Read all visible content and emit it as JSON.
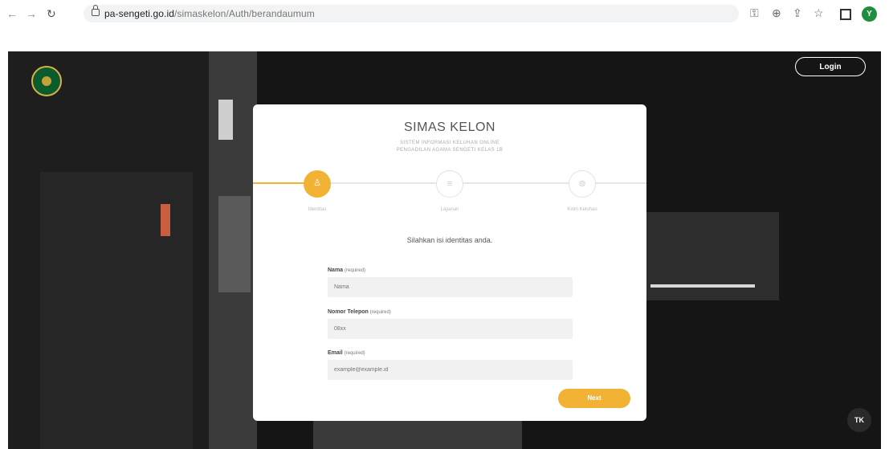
{
  "browser": {
    "url_host": "pa-sengeti.go.id",
    "url_path": "/simaskelon/Auth/berandaumum",
    "profile_initial": "Y"
  },
  "header": {
    "login_label": "Login"
  },
  "card": {
    "title": "SIMAS KELON",
    "subtitle_line1": "SISTEM INFORMASI KELUHAN ONLINE",
    "subtitle_line2": "PENGADILAN AGAMA SENGETI KELAS 1B",
    "steps": [
      {
        "label": "Identitas"
      },
      {
        "label": "Layanan"
      },
      {
        "label": "Kirim Keluhan"
      }
    ],
    "prompt": "Silahkan isi identitas anda.",
    "fields": {
      "name": {
        "label": "Nama",
        "req": "(required)",
        "placeholder": "Nama"
      },
      "phone": {
        "label": "Nomor Telepon",
        "req": "(required)",
        "placeholder": "08xx"
      },
      "email": {
        "label": "Email",
        "req": "(required)",
        "placeholder": "example@example.id"
      }
    },
    "next_label": "Next"
  },
  "widget": {
    "tk_label": "TK"
  },
  "colors": {
    "accent": "#f2b233",
    "hero_bg": "#151515",
    "card_bg": "#ffffff"
  }
}
